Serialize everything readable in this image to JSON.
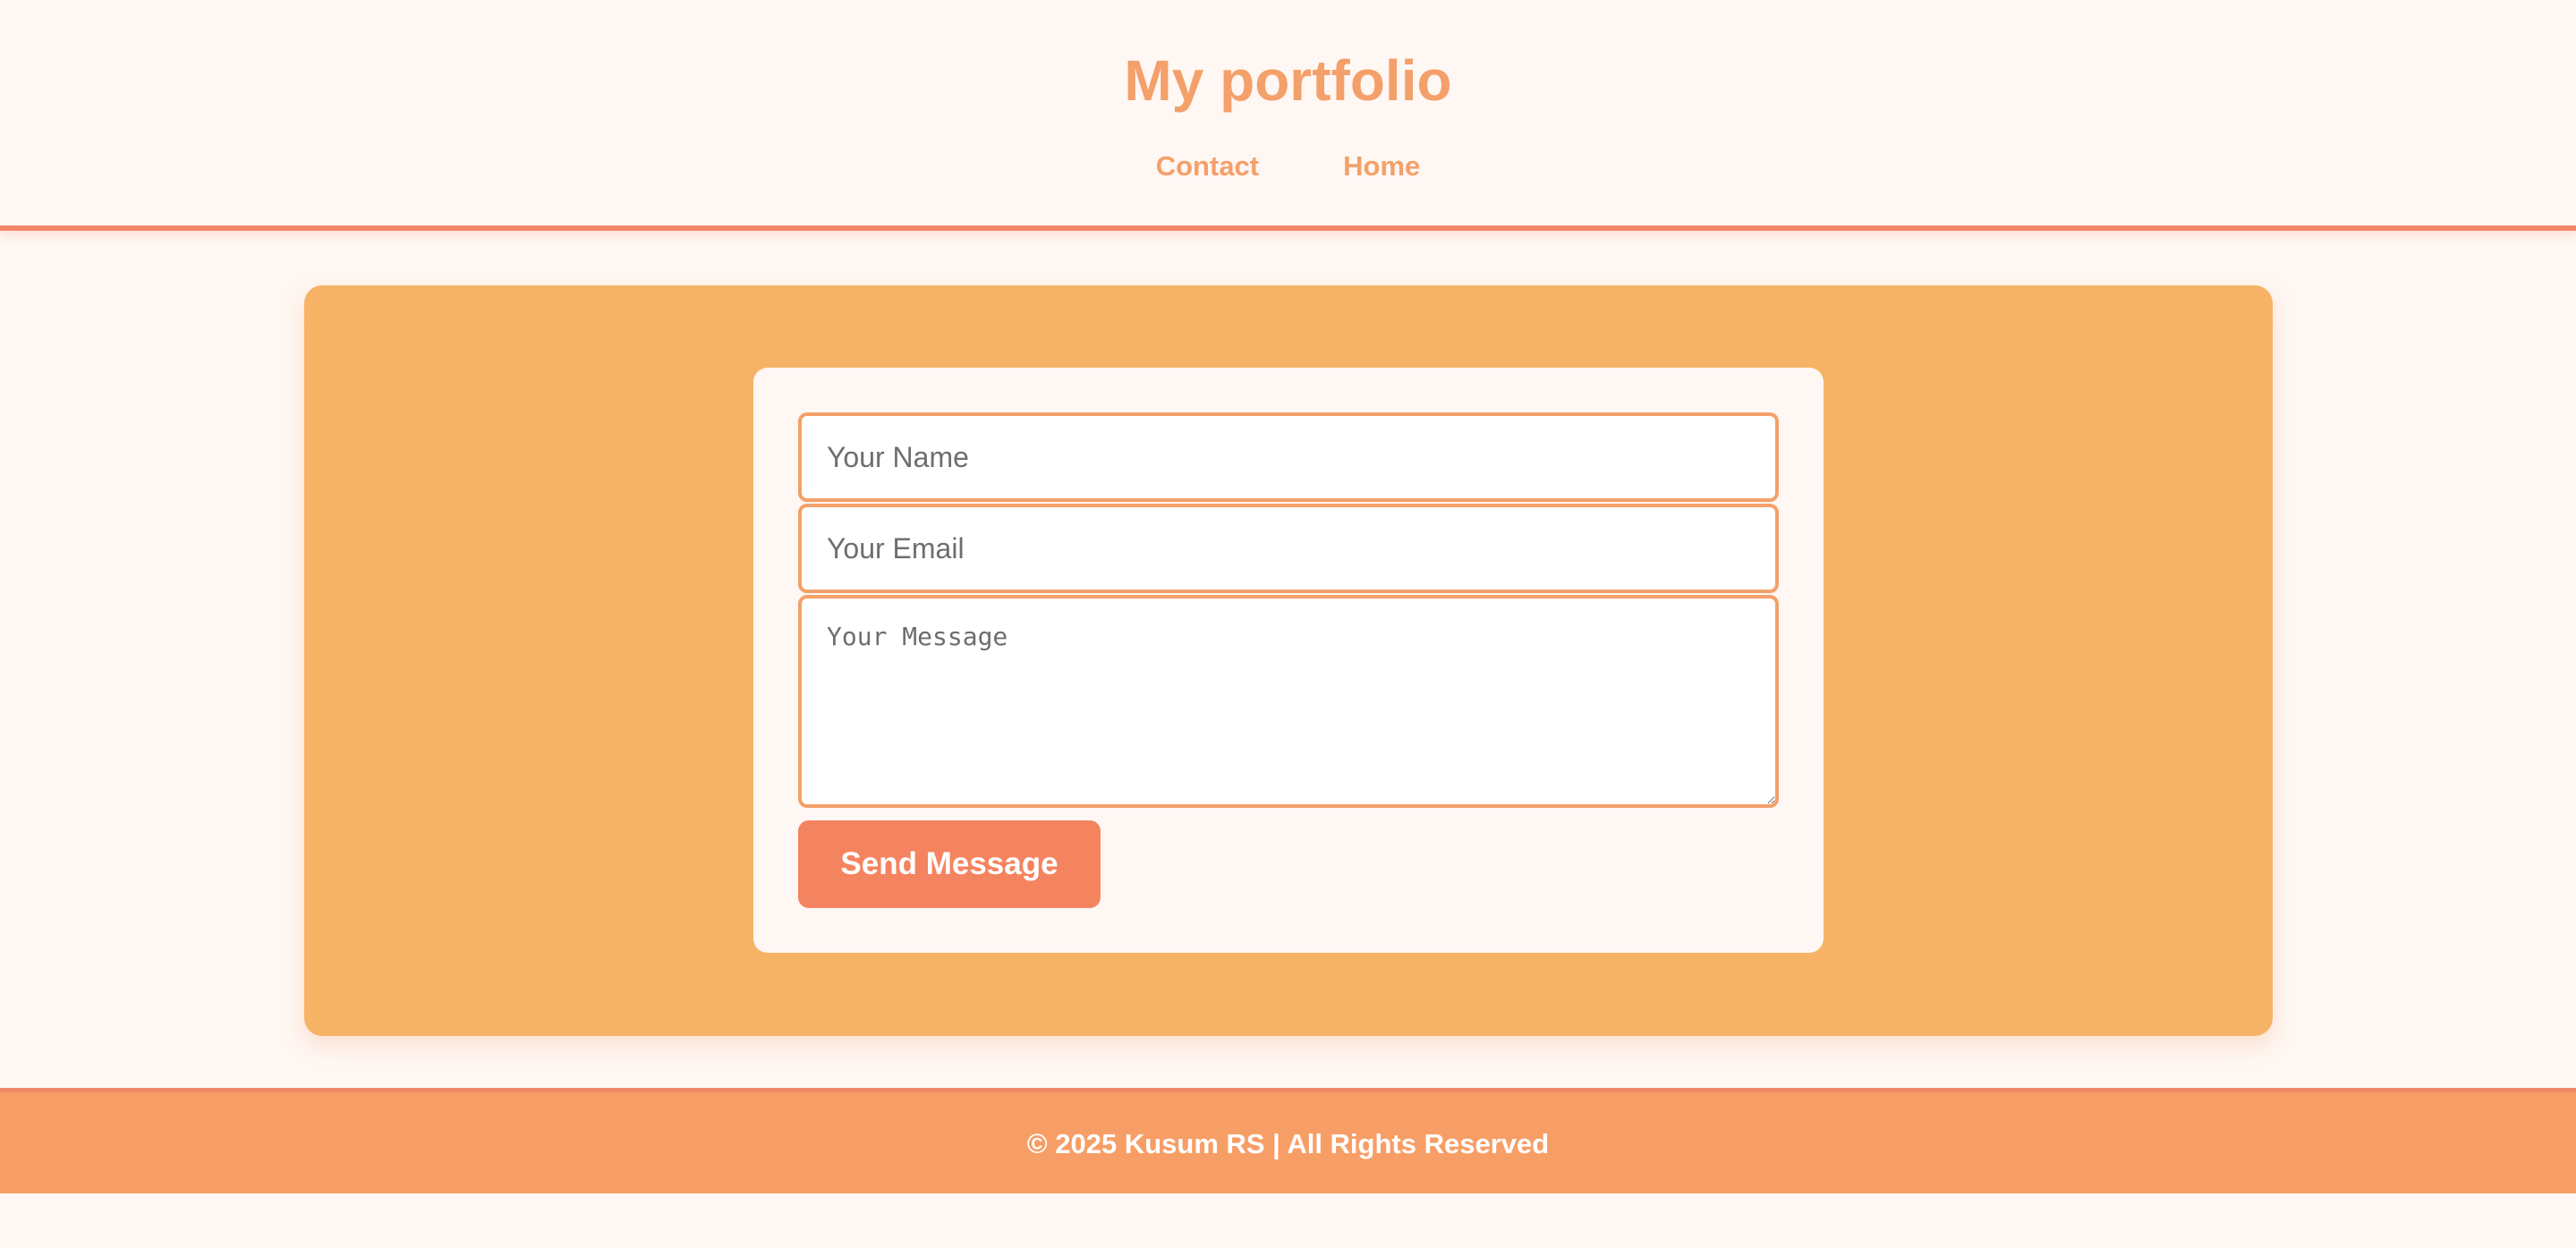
{
  "header": {
    "title": "My portfolio",
    "nav": [
      {
        "label": "Contact"
      },
      {
        "label": "Home"
      }
    ]
  },
  "contact_form": {
    "name_placeholder": "Your Name",
    "email_placeholder": "Your Email",
    "message_placeholder": "Your Message",
    "send_label": "Send Message"
  },
  "footer": {
    "text": "© 2025 Kusum RS | All Rights Reserved"
  },
  "colors": {
    "accent": "#f4a06a",
    "panel": "#f6b366",
    "button": "#f4845f",
    "footer": "#f79e66",
    "background": "#fff7f3"
  }
}
